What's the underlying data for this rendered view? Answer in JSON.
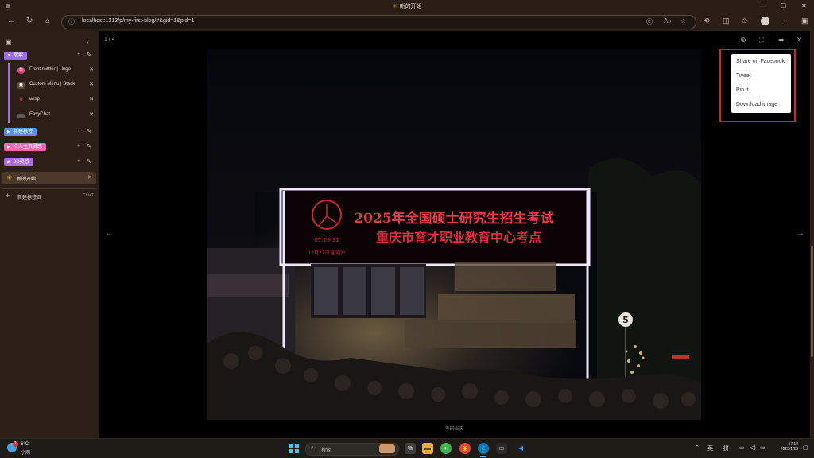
{
  "window": {
    "title": "新的开始",
    "icons": {
      "app": "workspaces-icon",
      "minimize": "minimize-icon",
      "maximize": "maximize-icon",
      "close": "close-icon"
    }
  },
  "navbar": {
    "url": "localhost:1313/p/my-first-blog/#&gid=1&pid=1"
  },
  "sidebar": {
    "groups": [
      {
        "label": "搜索",
        "color": "#9b6fe8",
        "expanded": true
      },
      {
        "label": "新建标签",
        "color": "#5b8ef0",
        "expanded": false
      },
      {
        "label": "个人主页灵感",
        "color": "#e86ab0",
        "expanded": false
      },
      {
        "label": "3D灵感",
        "color": "#b06ae0",
        "expanded": false
      }
    ],
    "tabs": [
      {
        "label": "Front matter | Hugo",
        "icon": "H",
        "icon_color": "#e8417a"
      },
      {
        "label": "Custom Menu | Stack",
        "icon": "▣",
        "icon_color": "#5a4a3c"
      },
      {
        "label": "wrap",
        "icon": "U",
        "icon_color": "#c0232c"
      },
      {
        "label": "EasyChat",
        "icon": "▬",
        "icon_color": "#5a5a5a"
      }
    ],
    "active_tab": {
      "label": "新的开始"
    },
    "new_tab": {
      "label": "新建标签页",
      "shortcut": "Ctrl+T"
    }
  },
  "viewer": {
    "counter": "1 / 4",
    "caption": "考研当天",
    "sign": {
      "line1": "2025年全国硕士研究生招生考试",
      "line2": "重庆市育才职业教育中心考点",
      "time": "07:19:31",
      "date": "12月21日 星期六",
      "speed_sign": "5"
    },
    "share_menu": [
      "Share on Facebook",
      "Tweet",
      "Pin it",
      "Download image"
    ]
  },
  "taskbar": {
    "weather_temp": "6°C",
    "weather_cond": "小雨",
    "weather_badge": "1",
    "search_placeholder": "搜索",
    "ime_lang": "英",
    "ime_mode": "拼",
    "time": "17:18",
    "date": "2025/1/25"
  }
}
